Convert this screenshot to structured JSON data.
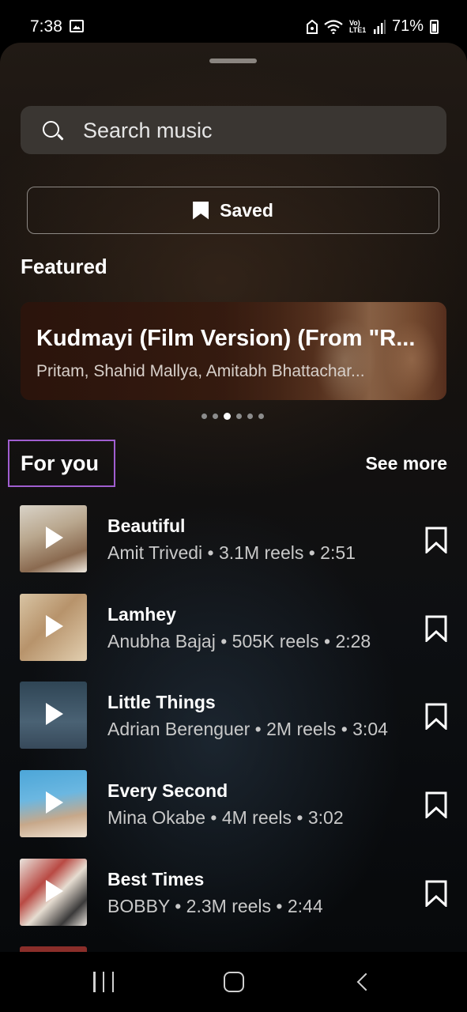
{
  "status_bar": {
    "time": "7:38",
    "network": "Vo) LTE1",
    "battery": "71%",
    "icons": [
      "gallery-icon",
      "data-saver-icon",
      "wifi-icon",
      "signal-icon",
      "battery-icon"
    ]
  },
  "search": {
    "placeholder": "Search music"
  },
  "saved": {
    "label": "Saved"
  },
  "featured": {
    "heading": "Featured",
    "title": "Kudmayi (Film Version) (From \"R...",
    "subtitle": "Pritam, Shahid Mallya, Amitabh Bhattachar...",
    "page_count": 6,
    "active_page": 2
  },
  "for_you": {
    "heading": "For you",
    "see_more": "See more",
    "tracks": [
      {
        "title": "Beautiful",
        "meta": "Amit Trivedi • 3.1M reels • 2:51"
      },
      {
        "title": "Lamhey",
        "meta": "Anubha Bajaj • 505K reels • 2:28"
      },
      {
        "title": "Little Things",
        "meta": "Adrian Berenguer • 2M reels • 3:04"
      },
      {
        "title": "Every Second",
        "meta": "Mina Okabe • 4M reels • 3:02"
      },
      {
        "title": "Best Times",
        "meta": "BOBBY • 2.3M reels • 2:44"
      }
    ]
  },
  "colors": {
    "highlight_box": "#a05ed0",
    "search_bg": "#3a3632"
  }
}
